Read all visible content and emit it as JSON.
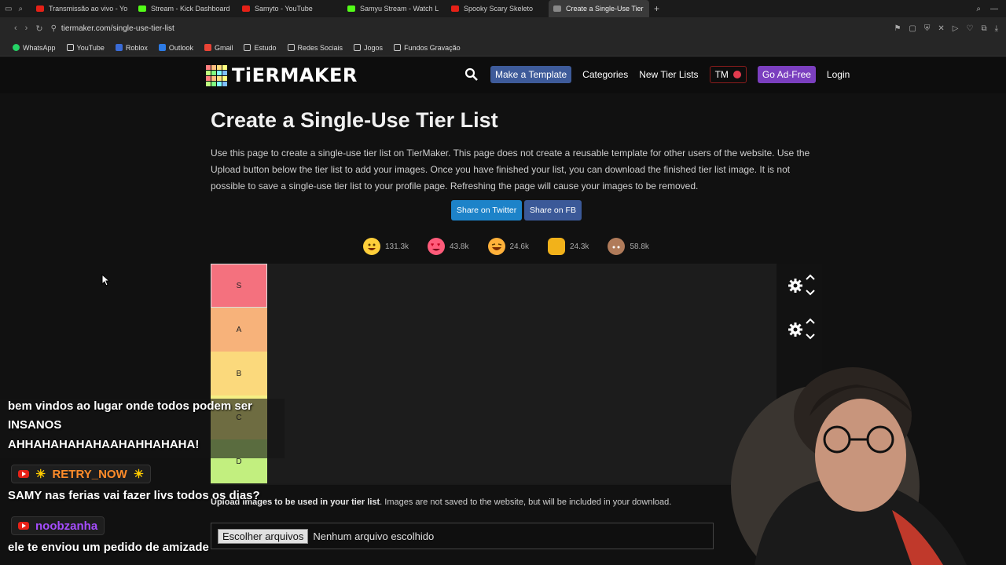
{
  "browser": {
    "tabs": [
      {
        "title": "Transmissão ao vivo - Yo",
        "color": "#e62117"
      },
      {
        "title": "Stream - Kick Dashboard",
        "color": "#53fc18"
      },
      {
        "title": "Samyto - YouTube",
        "color": "#e62117"
      },
      {
        "title": "Samyu Stream - Watch L",
        "color": "#53fc18"
      },
      {
        "title": "Spooky Scary Skeleto",
        "color": "#e62117"
      },
      {
        "title": "Create a Single-Use Tier",
        "color": "#888888"
      }
    ],
    "url": "tiermaker.com/single-use-tier-list",
    "bookmarks": [
      {
        "label": "WhatsApp",
        "color": "#25d366"
      },
      {
        "label": "YouTube",
        "color": "#ffffff"
      },
      {
        "label": "Roblox",
        "color": "#3a6bd6"
      },
      {
        "label": "Outlook",
        "color": "#2d7be5"
      },
      {
        "label": "Gmail",
        "color": "#ea4335"
      },
      {
        "label": "Estudo",
        "color": "#cccccc"
      },
      {
        "label": "Redes Sociais",
        "color": "#cccccc"
      },
      {
        "label": "Jogos",
        "color": "#cccccc"
      },
      {
        "label": "Fundos Gravação",
        "color": "#cccccc"
      }
    ]
  },
  "header": {
    "logo_text": "TiERMAKER",
    "nav": {
      "make_template": "Make a Template",
      "categories": "Categories",
      "new_tier_lists": "New Tier Lists",
      "tm": "TM",
      "go_ad_free": "Go Ad-Free",
      "login": "Login"
    }
  },
  "main": {
    "title": "Create a Single-Use Tier List",
    "intro": "Use this page to create a single-use tier list on TierMaker. This page does not create a reusable template for other users of the website. Use the Upload button below the tier list to add your images. Once you have finished your list, you can download the finished tier list image. It is not possible to save a single-use tier list to your profile page. Refreshing the page will cause your images to be removed.",
    "share_twitter": "Share on Twitter",
    "share_fb": "Share on FB",
    "reactions": [
      {
        "count": "131.3k",
        "color": "#ffcf3a"
      },
      {
        "count": "43.8k",
        "color": "#ff5b7a"
      },
      {
        "count": "24.6k",
        "color": "#ffb13a"
      },
      {
        "count": "24.3k",
        "color": "#f2b21a"
      },
      {
        "count": "58.8k",
        "color": "#b07b5a"
      }
    ],
    "tiers": [
      {
        "label": "S",
        "color": "#f4717e"
      },
      {
        "label": "A",
        "color": "#f7b27a"
      },
      {
        "label": "B",
        "color": "#fbd97c"
      },
      {
        "label": "C",
        "color": "#f5ef84"
      },
      {
        "label": "D",
        "color": "#c2ef7f"
      }
    ],
    "upload_note_bold": "Upload images to be used in your tier list",
    "upload_note_rest": ". Images are not saved to the website, but will be included in your download.",
    "file_button": "Escolher arquivos",
    "file_status": "Nenhum arquivo escolhido"
  },
  "chat": {
    "line1": "bem vindos ao lugar onde todos podem ser",
    "line2": "INSANOS",
    "line3": "AHHAHAHAHAHAAHAHHAHAHA!",
    "user1": "RETRY_NOW",
    "user1_color": "#ff8c2a",
    "msg1": "SAMY nas ferias vai fazer livs todos os dias?",
    "user2": "noobzanha",
    "user2_color": "#a64dff",
    "msg2": "ele te enviou um pedido de amizade"
  }
}
